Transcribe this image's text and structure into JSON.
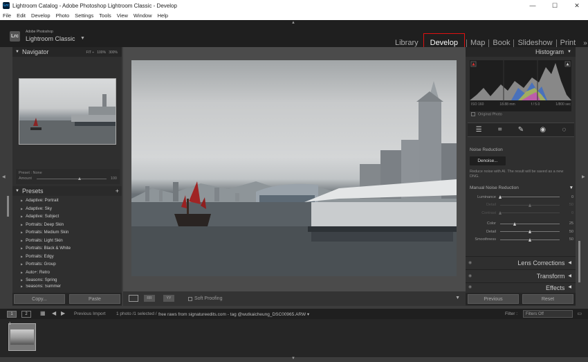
{
  "window": {
    "title": "Lightroom Catalog - Adobe Photoshop Lightroom Classic - Develop",
    "app_icon": "Lrc"
  },
  "menu": [
    "File",
    "Edit",
    "Develop",
    "Photo",
    "Settings",
    "Tools",
    "View",
    "Window",
    "Help"
  ],
  "brand": {
    "badge": "Lrc",
    "small": "Adobe Photoshop",
    "name": "Lightroom Classic"
  },
  "modules": [
    "Library",
    "Develop",
    "Map",
    "Book",
    "Slideshow",
    "Print"
  ],
  "active_module": "Develop",
  "navigator": {
    "title": "Navigator",
    "zoom": [
      "FIT ÷",
      "100%",
      "300%"
    ]
  },
  "preset_box": {
    "label": "Preset : None",
    "amount_label": "Amount",
    "amount_value": "100"
  },
  "presets": {
    "title": "Presets",
    "items": [
      "Adaptive: Portrait",
      "Adaptive: Sky",
      "Adaptive: Subject",
      "Portraits: Deep Skin",
      "Portraits: Medium Skin",
      "Portraits: Light Skin",
      "Portraits: Black & White",
      "Portraits: Edgy",
      "Portraits: Group",
      "Auto+: Retro",
      "Seasons: Spring",
      "Seasons: Summer"
    ]
  },
  "left_buttons": {
    "copy": "Copy...",
    "paste": "Paste"
  },
  "toolbar": {
    "soft_proofing": "Soft Proofing"
  },
  "histogram": {
    "title": "Histogram",
    "iso": "ISO 160",
    "focal": "18.88 mm",
    "aperture": "f / 5.0",
    "shutter": "1/800 sec",
    "original_photo": "Original Photo"
  },
  "noise_reduction": {
    "title": "Noise Reduction",
    "denoise": "Denoise...",
    "desc": "Reduce noise with AI. The result will be saved as a new DNG.",
    "manual": "Manual Noise Reduction",
    "sliders": [
      {
        "label": "Luminance",
        "value": "0",
        "pos": 0.0
      },
      {
        "label": "Detail",
        "value": "50",
        "pos": 0.5
      },
      {
        "label": "Contrast",
        "value": "0",
        "pos": 0.0
      },
      {
        "label": "Color",
        "value": "25",
        "pos": 0.25
      },
      {
        "label": "Detail",
        "value": "50",
        "pos": 0.5
      },
      {
        "label": "Smoothness",
        "value": "50",
        "pos": 0.5
      }
    ]
  },
  "right_sections": {
    "lens": "Lens Corrections",
    "transform": "Transform",
    "effects": "Effects"
  },
  "right_buttons": {
    "previous": "Previous",
    "reset": "Reset"
  },
  "filmbar": {
    "page1": "1",
    "page2": "2",
    "previous_import": "Previous Import",
    "info_count": "1 photo /1 selected /",
    "info_path": "free raws from signatureedits.com - tag @wutkaicheung_DSC00965.ARW ▾",
    "filter_label": "Filter :",
    "filter_value": "Filters Off"
  },
  "film_index": "1"
}
